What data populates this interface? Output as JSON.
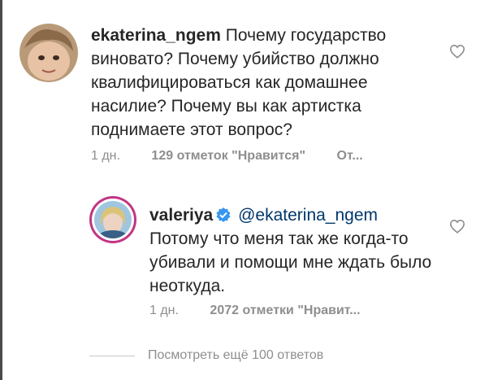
{
  "comments": [
    {
      "username": "ekaterina_ngem",
      "text": "Почему государство виновато? Почему убийство должно квалифицироваться как домашнее насилие? Почему вы как артистка поднимаете этот вопрос?",
      "time": "1 дн.",
      "likes": "129 отметок \"Нравится\"",
      "reply": "От..."
    },
    {
      "username": "valeriya",
      "verified": true,
      "mention": "@ekaterina_ngem",
      "text": "Потому что меня так же когда-то убивали и помощи мне ждать было неоткуда.",
      "time": "1 дн.",
      "likes": "2072 отметки \"Нравит..."
    }
  ],
  "view_more": "Посмотреть ещё 100 ответов",
  "colors": {
    "text": "#262626",
    "secondary": "#8e8e8e",
    "mention": "#00376b",
    "verified": "#3897f0",
    "story_ring": "#c13584"
  },
  "icons": [
    "heart-icon",
    "verified-badge-icon"
  ]
}
